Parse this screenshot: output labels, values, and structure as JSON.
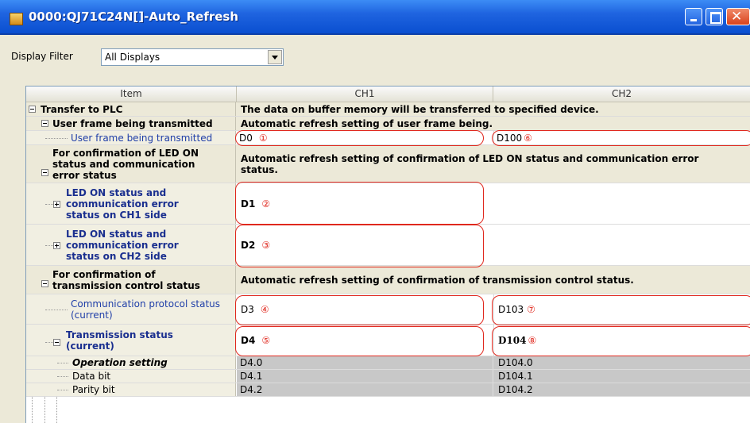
{
  "window": {
    "title": "0000:QJ71C24N[]-Auto_Refresh"
  },
  "filter": {
    "label": "Display Filter",
    "value": "All Displays"
  },
  "columns": {
    "item": "Item",
    "ch1": "CH1",
    "ch2": "CH2"
  },
  "rows": {
    "transfer_to_plc": {
      "item": "Transfer to PLC",
      "text": "The data on buffer memory will be transferred to specified device."
    },
    "user_frame_group": {
      "item": "User frame being transmitted",
      "text": "Automatic refresh setting of user frame being."
    },
    "user_frame": {
      "item": "User frame being transmitted",
      "ch1": "D0",
      "ch1_mark": "①",
      "ch2": "D100",
      "ch2_mark": "⑥"
    },
    "led_group": {
      "item_line1": "For confirmation of LED ON",
      "item_line2": "status and communication",
      "item_line3": "error status",
      "text_line1": "Automatic refresh setting of confirmation of LED ON status and communication error",
      "text_line2": "status."
    },
    "led_ch1": {
      "item_line1": "LED ON status and",
      "item_line2": "communication error",
      "item_line3": "status on CH1 side",
      "ch1": "D1",
      "ch1_mark": "②"
    },
    "led_ch2": {
      "item_line1": "LED ON status and",
      "item_line2": "communication error",
      "item_line3": "status on CH2 side",
      "ch1": "D2",
      "ch1_mark": "③"
    },
    "tx_group": {
      "item_line1": "For confirmation of",
      "item_line2": "transmission control status",
      "text": "Automatic refresh setting of confirmation of transmission control status."
    },
    "protocol": {
      "item_line1": "Communication protocol status",
      "item_line2": "(current)",
      "ch1": "D3",
      "ch1_mark": "④",
      "ch2": "D103",
      "ch2_mark": "⑦"
    },
    "tx_status": {
      "item_line1": "Transmission status",
      "item_line2": "(current)",
      "ch1": "D4",
      "ch1_mark": "⑤",
      "ch2": "D104",
      "ch2_mark": "⑧"
    },
    "operation": {
      "item": "Operation setting",
      "ch1": "D4.0",
      "ch2": "D104.0"
    },
    "data_bit": {
      "item": "Data bit",
      "ch1": "D4.1",
      "ch2": "D104.1"
    },
    "parity_bit": {
      "item": "Parity bit",
      "ch1": "D4.2",
      "ch2": "D104.2"
    }
  },
  "colors": {
    "highlight": "#e0281e",
    "link_blue": "#1f3ea8",
    "titlebar": "#1f64e0"
  }
}
